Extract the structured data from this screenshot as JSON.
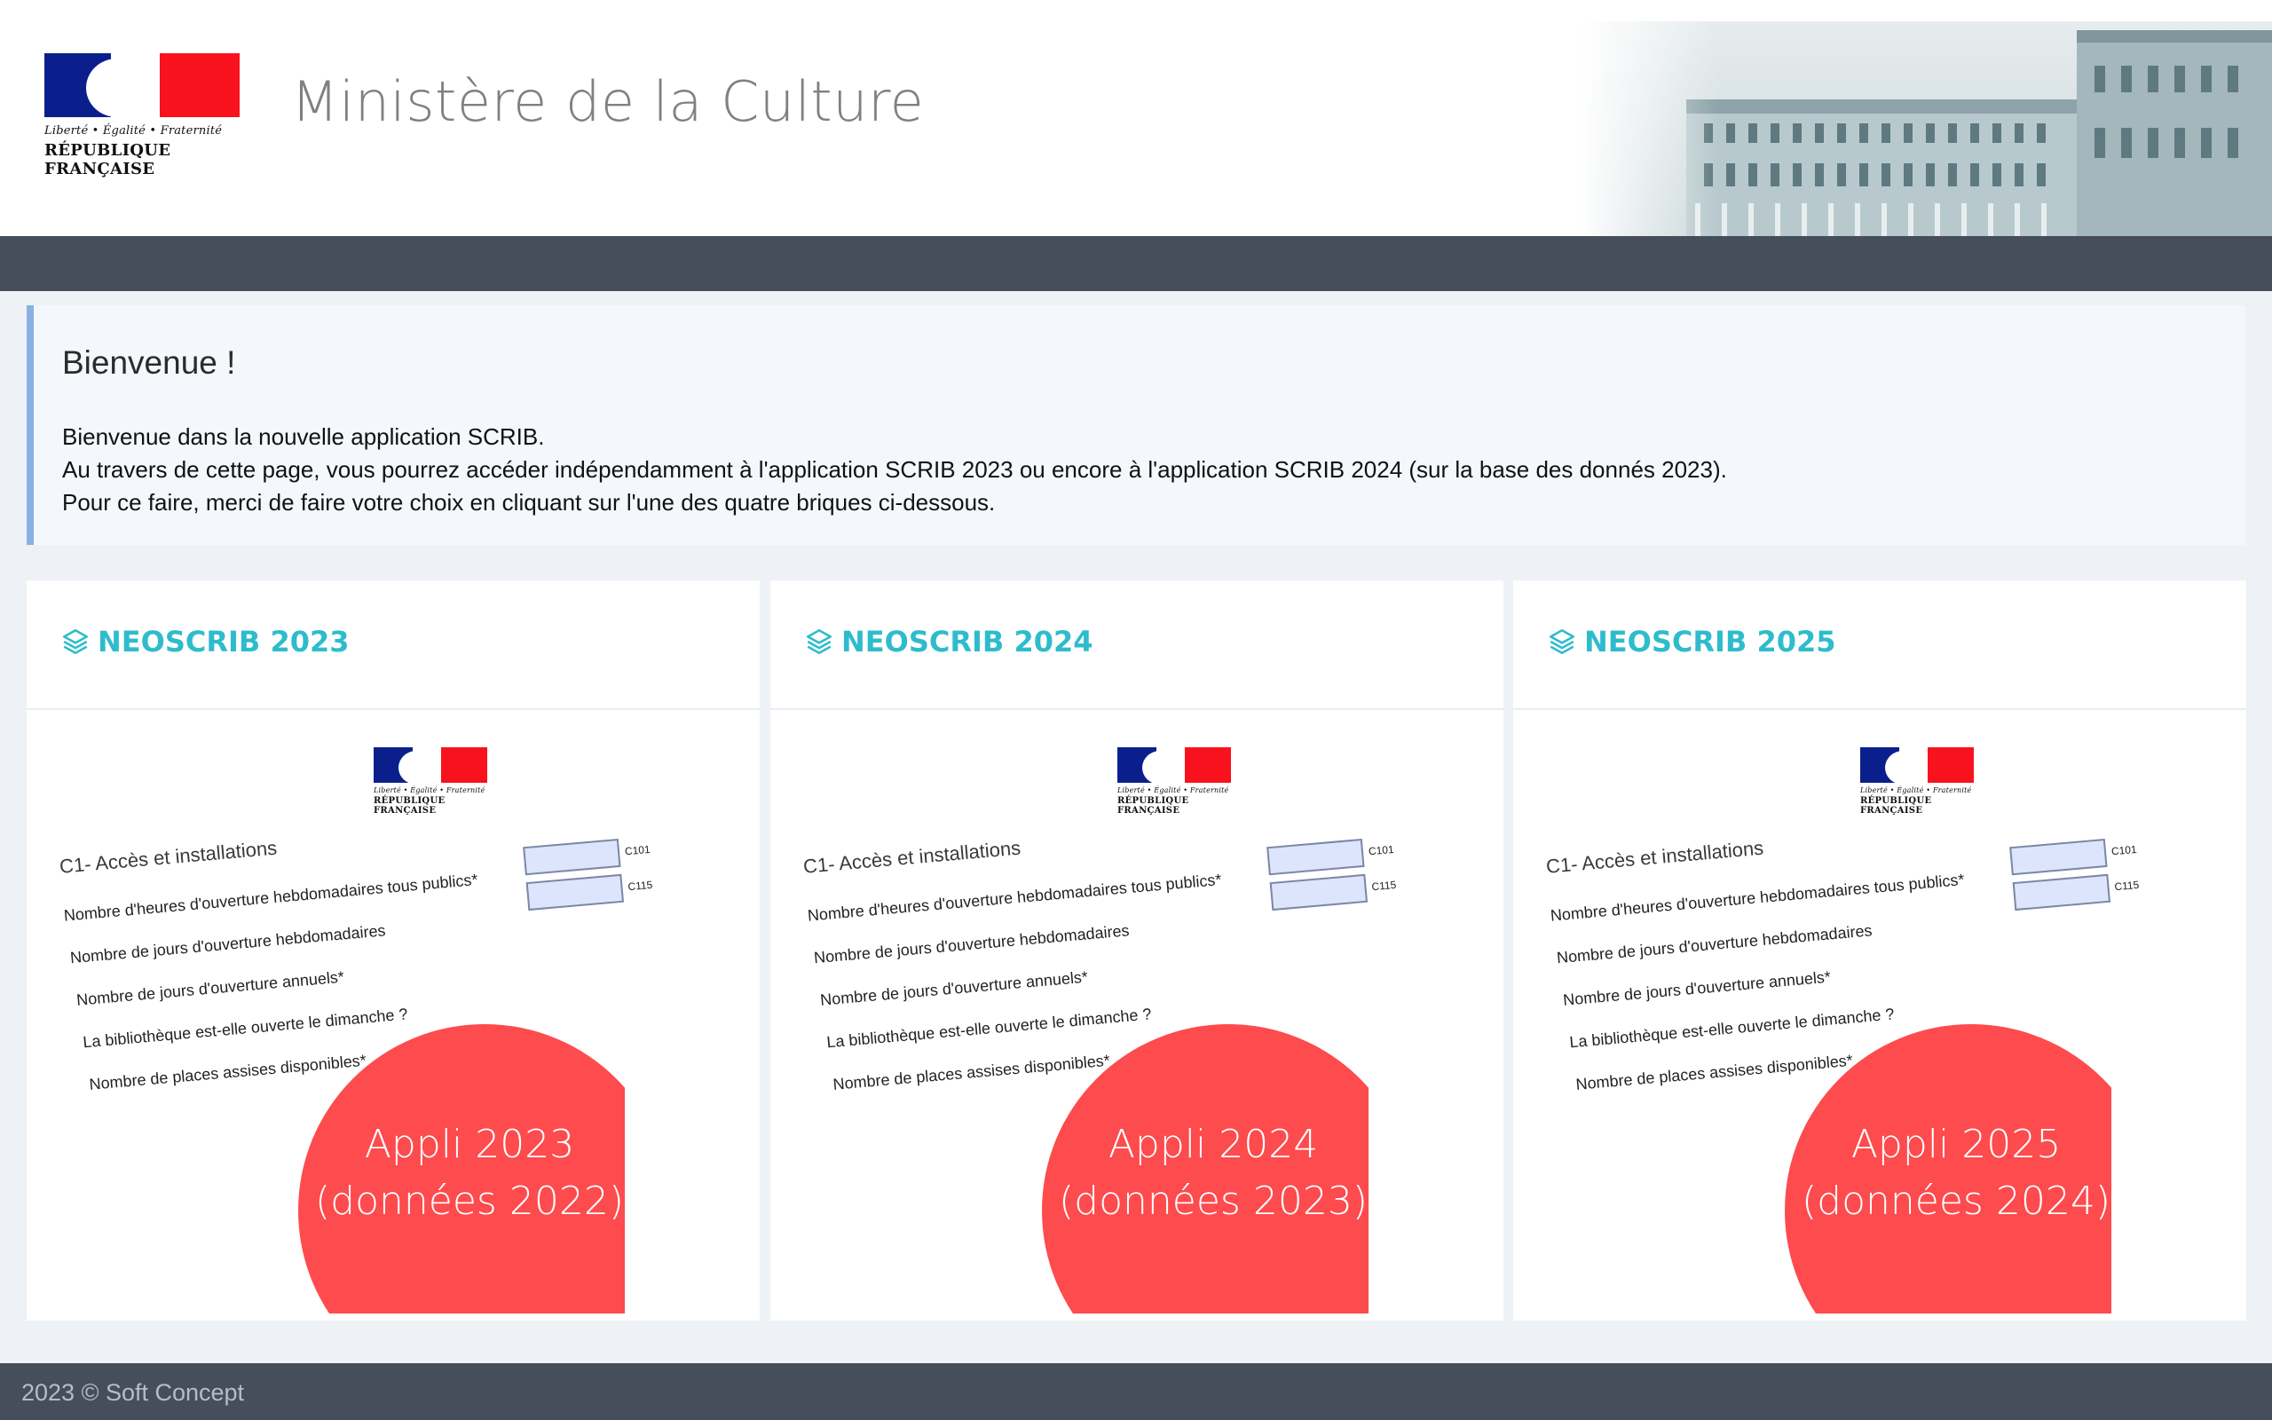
{
  "header": {
    "logo": {
      "devise": "Liberté • Égalité • Fraternité",
      "republique": "RÉPUBLIQUE FRANÇAISE"
    },
    "ministry": "Ministère de la Culture"
  },
  "welcome": {
    "title": "Bienvenue !",
    "line1": "Bienvenue dans la nouvelle application SCRIB.",
    "line2": "Au travers de cette page, vous pourrez accéder indépendamment à l'application SCRIB 2023 ou encore à l'application SCRIB 2024 (sur la base des donnés 2023).",
    "line3": "Pour ce faire, merci de faire votre choix en cliquant sur l'une des quatre briques ci-dessous."
  },
  "preview": {
    "section": "C1- Accès et installations",
    "q1": "Nombre d'heures d'ouverture hebdomadaires tous publics*",
    "q2": "Nombre de jours d'ouverture hebdomadaires",
    "q3": "Nombre de jours d'ouverture annuels*",
    "q4": "La bibliothèque est-elle ouverte le dimanche ?",
    "q5": "Nombre de places assises disponibles*",
    "code1": "C101",
    "code2": "C115"
  },
  "cards": [
    {
      "title": "NEOSCRIB 2023",
      "appli_line1": "Appli 2023",
      "appli_line2": "(données 2022)"
    },
    {
      "title": "NEOSCRIB 2024",
      "appli_line1": "Appli 2024",
      "appli_line2": "(données 2023)"
    },
    {
      "title": "NEOSCRIB 2025",
      "appli_line1": "Appli 2025",
      "appli_line2": "(données 2024)"
    }
  ],
  "footer": {
    "copyright": "2023 © Soft Concept"
  },
  "colors": {
    "navbar": "#474e5b",
    "accent_teal": "#2ebccd",
    "welcome_border": "#8ab0e2",
    "appli_red": "#fd4b4e",
    "flag_blue": "#0b1f8c",
    "flag_red": "#f8121e"
  },
  "icons": {
    "card_icon": "layers-icon"
  }
}
